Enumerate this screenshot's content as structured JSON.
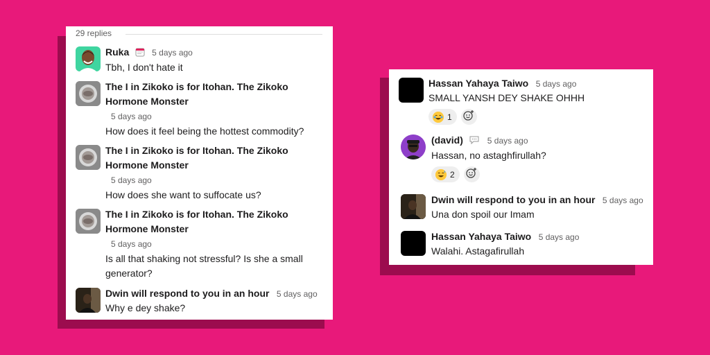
{
  "left_thread": {
    "replies_label": "29 replies",
    "messages": [
      {
        "author": "Ruka",
        "time": "5 days ago",
        "text": "Tbh, I don't hate it",
        "status_icon": "calendar-icon"
      },
      {
        "author": "The I in Zikoko is for Itohan. The Zikoko Hormone Monster",
        "time": "5 days ago",
        "text": "How does it feel being the hottest commodity?"
      },
      {
        "author": "The I in Zikoko is for Itohan. The Zikoko Hormone Monster",
        "time": "5 days ago",
        "text": "How does she want to suffocate us?"
      },
      {
        "author": "The I in Zikoko is for Itohan. The Zikoko Hormone Monster",
        "time": "5 days ago",
        "text": "Is all that shaking not stressful? Is she a small generator?"
      },
      {
        "author": "Dwin will respond to you in an hour",
        "time": "5 days ago",
        "text": "Why e dey shake?"
      }
    ]
  },
  "right_thread": {
    "messages": [
      {
        "author": "Hassan Yahaya Taiwo",
        "time": "5 days ago",
        "text": "SMALL YANSH DEY SHAKE OHHH",
        "reactions": [
          {
            "emoji": "joy-emoji",
            "count": "1"
          }
        ]
      },
      {
        "author": "(david)",
        "time": "5 days ago",
        "text": "Hassan, no astaghfirullah?",
        "status_icon": "speech-bubble-icon",
        "reactions": [
          {
            "emoji": "grinning-sweat-emoji",
            "count": "2"
          }
        ]
      },
      {
        "author": "Dwin will respond to you in an hour",
        "time": "5 days ago",
        "text": "Una don spoil our Imam"
      },
      {
        "author": "Hassan Yahaya Taiwo",
        "time": "5 days ago",
        "text": "Walahi. Astagafirullah"
      }
    ]
  },
  "colors": {
    "background": "#E8197A",
    "shadow": "#9C0C4E",
    "card": "#FFFFFF",
    "text": "#1D1C1D",
    "muted": "#616061",
    "reaction_bg": "#EEEEEE",
    "avatar_ruka_bg": "#3FD5A0",
    "avatar_david_bg": "#8E3FC9"
  }
}
